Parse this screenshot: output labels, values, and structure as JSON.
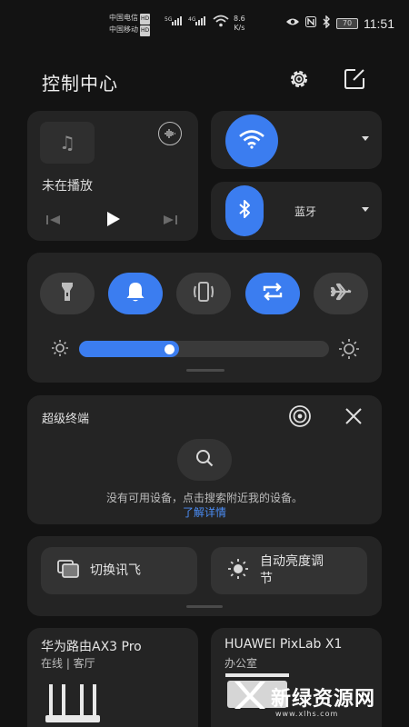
{
  "status_bar": {
    "carrier_1": "中国电信",
    "carrier_2": "中国移动",
    "hd_badge": "HD",
    "net_5g": "5G",
    "net_4g": "4G",
    "speed_value": "8.6",
    "speed_unit": "K/s",
    "battery": "70",
    "time": "11:51",
    "icons": [
      "eye-icon",
      "nfc-icon",
      "bluetooth-icon"
    ]
  },
  "header": {
    "title": "控制中心",
    "icons": [
      "gear-icon",
      "edit-icon"
    ]
  },
  "music": {
    "status": "未在播放",
    "icons": [
      "music-note-icon",
      "audio-switch-icon",
      "previous-icon",
      "play-icon",
      "next-icon"
    ]
  },
  "wifi": {
    "label": "",
    "active": true
  },
  "bluetooth": {
    "label": "蓝牙",
    "active": true
  },
  "toggles": [
    {
      "name": "flashlight",
      "active": false
    },
    {
      "name": "sound",
      "active": true
    },
    {
      "name": "vibrate",
      "active": false
    },
    {
      "name": "auto-rotate",
      "active": true
    },
    {
      "name": "airplane-mode",
      "active": false
    }
  ],
  "brightness": {
    "level": 0.4
  },
  "super_device": {
    "title": "超级终端",
    "empty_message": "没有可用设备，点击搜索附近我的设备。",
    "learn_more": "了解详情"
  },
  "shortcuts": [
    {
      "label": "切换讯飞",
      "icon": "switch-window-icon"
    },
    {
      "label_line1": "自动亮度调",
      "label_line2": "节",
      "icon": "brightness-icon"
    }
  ],
  "devices": [
    {
      "name": "华为路由AX3 Pro",
      "subtitle": "在线 | 客厅"
    },
    {
      "name": "HUAWEI PixLab X1",
      "subtitle": "办公室"
    }
  ],
  "watermark": {
    "text": "新绿资源网",
    "url": "www.xlhs.com"
  },
  "colors": {
    "accent": "#3b7df0",
    "card": "#242424",
    "background": "#131313",
    "link": "#4b8df5"
  }
}
